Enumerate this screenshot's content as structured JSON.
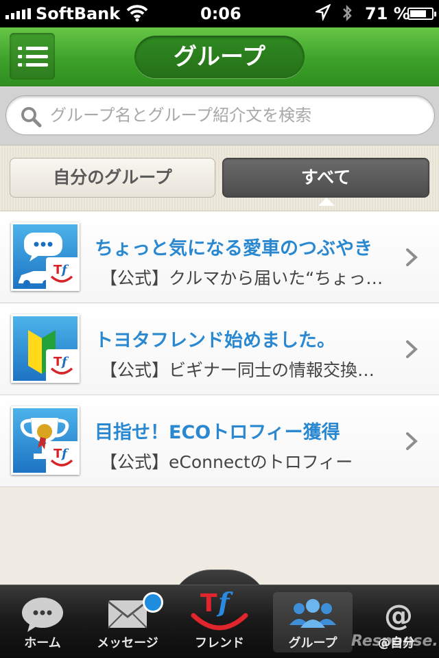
{
  "status_bar": {
    "carrier": "SoftBank",
    "time": "0:06",
    "battery": "71 %",
    "battery_level": 0.71
  },
  "header": {
    "title": "グループ"
  },
  "search": {
    "placeholder": "グループ名とグループ紹介文を検索"
  },
  "segments": {
    "mine": "自分のグループ",
    "all": "すべて",
    "selected": "all"
  },
  "groups": [
    {
      "title": "ちょっと気になる愛車のつぶやき",
      "description": "【公式】クルマから届いた“ちょっと気になる愛車のつぶやき”",
      "icon": "car-speech-icon"
    },
    {
      "title": "トヨタフレンド始めました。",
      "description": "【公式】ビギナー同士の情報交換の場です",
      "icon": "beginner-mark-icon"
    },
    {
      "title": "目指せ！ECOトロフィー獲得",
      "description": "【公式】eConnectのトロフィー",
      "icon": "trophy-icon"
    }
  ],
  "tabs": {
    "home": "ホーム",
    "messages": "メッセージ",
    "friend": "フレンド",
    "group": "グループ",
    "me": "@自分",
    "selected": "group"
  },
  "brand": {
    "logo_text": "Tf",
    "accent": "#3ea22a",
    "link_blue": "#2a88d0",
    "badge_blue": "#1e8de0"
  },
  "watermark": "Response."
}
